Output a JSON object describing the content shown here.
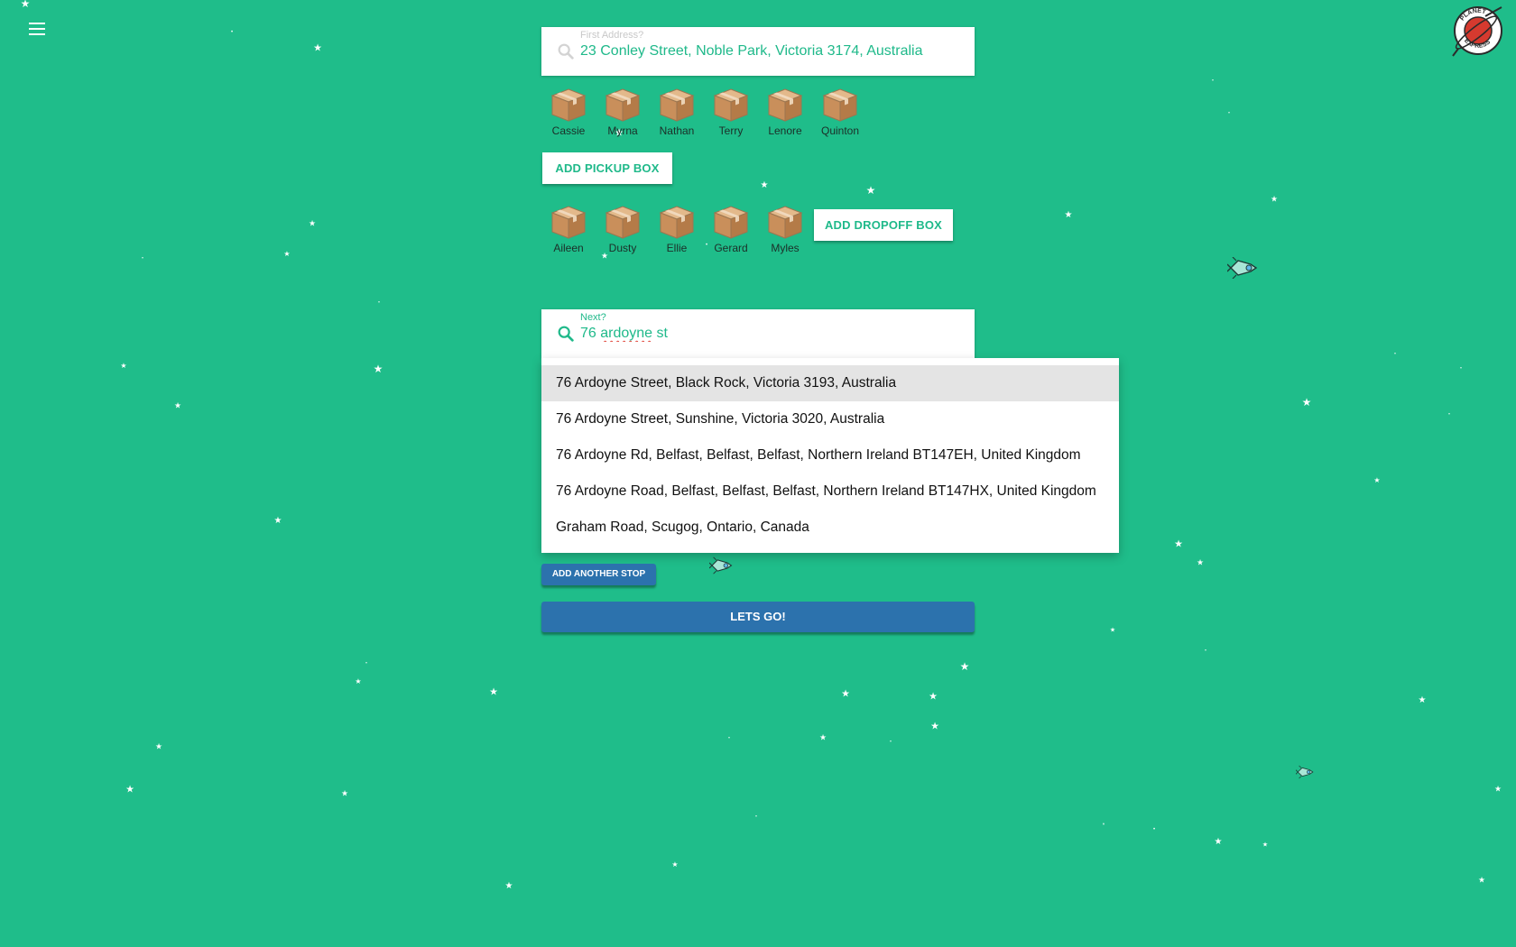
{
  "theme": {
    "background": "#1fbd8a",
    "accent_text": "#1fb98a",
    "primary_button": "#2c72ad",
    "card": "#ffffff",
    "highlight": "#e4e4e4",
    "star": "#ffffff"
  },
  "header": {
    "menu_icon": "hamburger-menu-icon",
    "logo_text": "PLANET EXPRESS"
  },
  "first_address": {
    "label": "First Address?",
    "value": "23 Conley Street, Noble Park, Victoria 3174, Australia",
    "icon": "search-icon"
  },
  "pickup_boxes": [
    {
      "name": "Cassie"
    },
    {
      "name": "Myrna"
    },
    {
      "name": "Nathan"
    },
    {
      "name": "Terry"
    },
    {
      "name": "Lenore"
    },
    {
      "name": "Quinton"
    }
  ],
  "add_pickup_label": "ADD PICKUP BOX",
  "dropoff_boxes": [
    {
      "name": "Aileen"
    },
    {
      "name": "Dusty"
    },
    {
      "name": "Ellie"
    },
    {
      "name": "Gerard"
    },
    {
      "name": "Myles"
    }
  ],
  "add_dropoff_label": "ADD DROPOFF BOX",
  "next_stop": {
    "label": "Next?",
    "value_prefix": "76 ",
    "value_misspelled": "ardoyne",
    "value_suffix": " st",
    "icon": "search-icon"
  },
  "suggestions": [
    "76 Ardoyne Street, Black Rock, Victoria 3193, Australia",
    "76 Ardoyne Street, Sunshine, Victoria 3020, Australia",
    "76 Ardoyne Rd, Belfast, Belfast, Belfast, Northern Ireland BT147EH, United Kingdom",
    "76 Ardoyne Road, Belfast, Belfast, Belfast, Northern Ireland BT147HX, United Kingdom",
    "Graham Road, Scugog, Ontario, Canada"
  ],
  "add_stop_label": "ADD ANOTHER STOP",
  "go_label": "LETS GO!"
}
